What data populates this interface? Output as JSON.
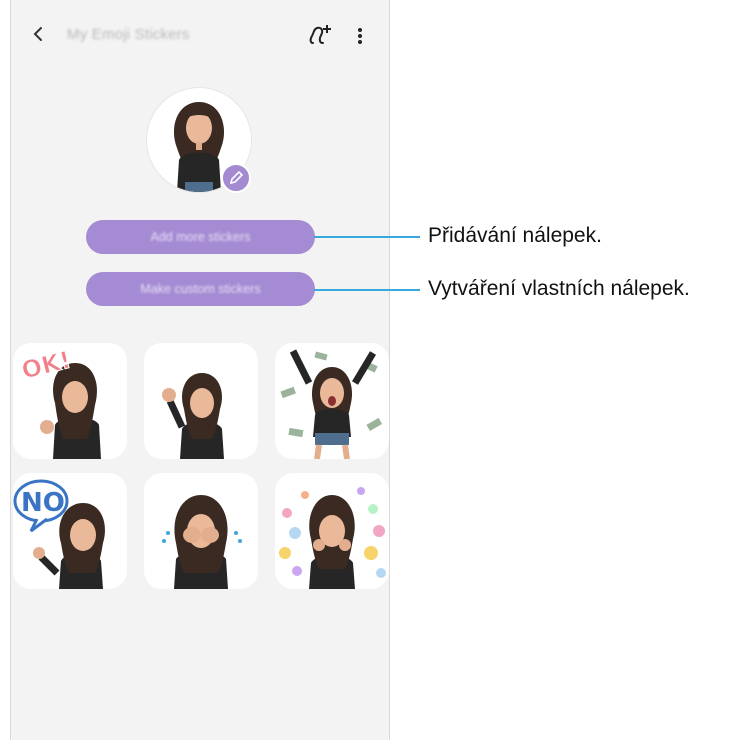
{
  "header": {
    "title": "My Emoji Stickers",
    "back_icon": "chevron-left-icon",
    "add_icon": "add-emoji-icon",
    "more_icon": "more-vert-icon"
  },
  "buttons": {
    "add_more": "Add more stickers",
    "make_custom": "Make custom stickers"
  },
  "callouts": {
    "add_more": "Přidávání nálepek.",
    "make_custom": "Vytváření vlastních nálepek."
  },
  "stickers": [
    {
      "name": "sticker-ok",
      "text": "OK!"
    },
    {
      "name": "sticker-wave",
      "text": ""
    },
    {
      "name": "sticker-money-rain",
      "text": ""
    },
    {
      "name": "sticker-no",
      "text": "NO"
    },
    {
      "name": "sticker-crying",
      "text": ""
    },
    {
      "name": "sticker-hearts",
      "text": ""
    }
  ],
  "colors": {
    "accent": "#a58bd3",
    "callout_line": "#3aa7df",
    "background": "#f3f3f3"
  }
}
